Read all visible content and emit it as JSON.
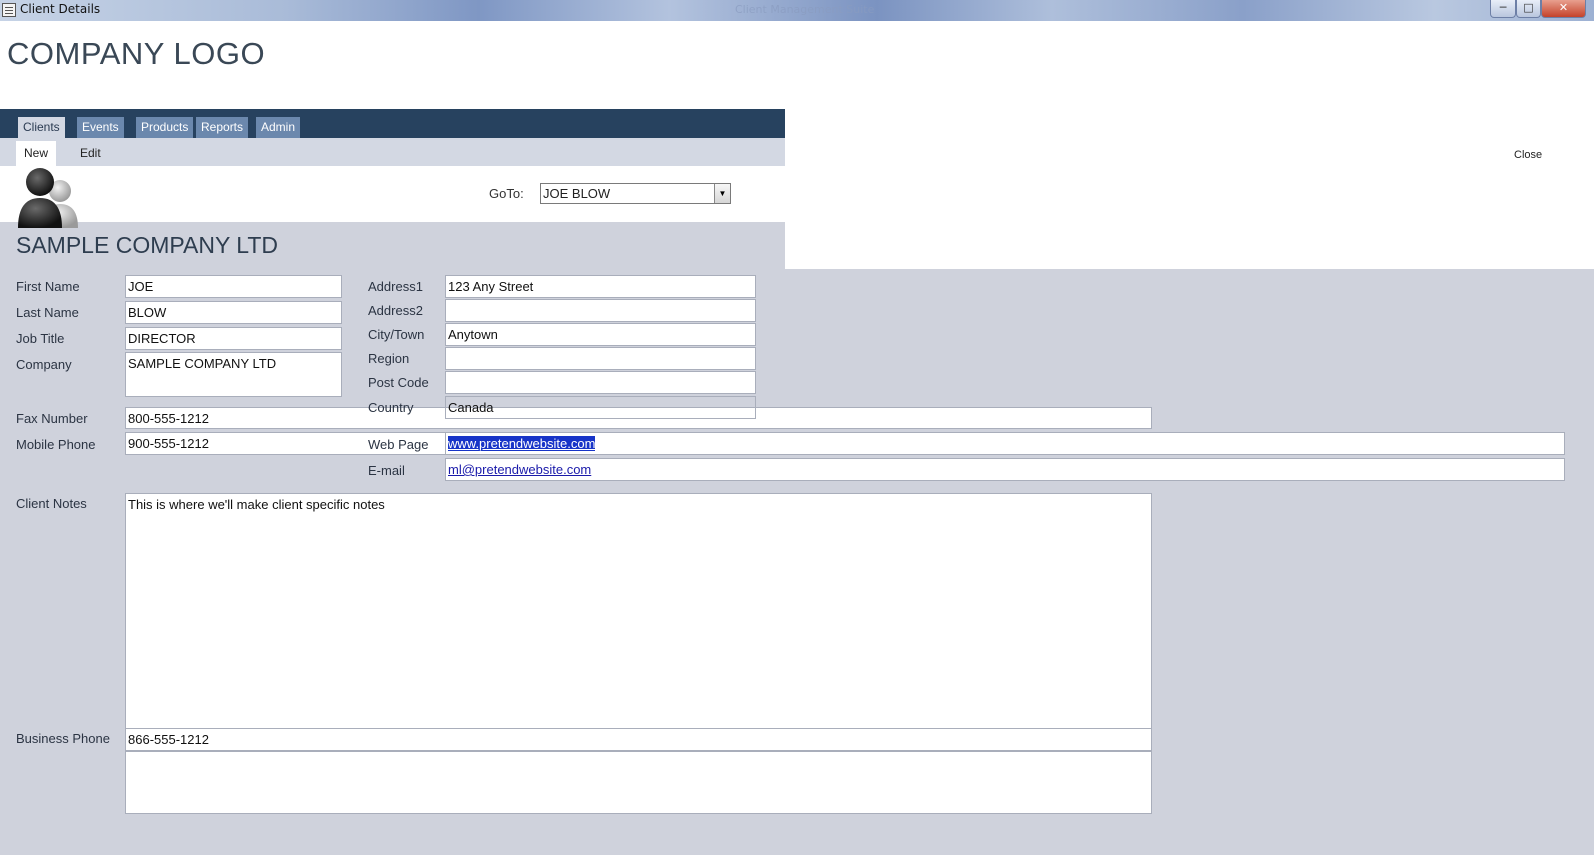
{
  "window": {
    "title": "Client Details",
    "ghost_title": "Client Management Suite",
    "controls": {
      "minimize": "─",
      "maximize": "□",
      "close": "✕"
    }
  },
  "branding": {
    "logo_text": "COMPANY LOGO"
  },
  "nav": {
    "tabs": [
      {
        "label": "Clients",
        "active": true
      },
      {
        "label": "Events",
        "active": false
      },
      {
        "label": "Products",
        "active": false
      },
      {
        "label": "Reports",
        "active": false
      },
      {
        "label": "Admin",
        "active": false
      }
    ],
    "subtabs": [
      {
        "label": "New",
        "active": true
      },
      {
        "label": "Edit",
        "active": false
      }
    ],
    "close_label": "Close"
  },
  "goto": {
    "label": "GoTo:",
    "value": "JOE BLOW"
  },
  "company_heading": "SAMPLE COMPANY LTD",
  "fields": {
    "first_name": {
      "label": "First Name",
      "value": "JOE"
    },
    "last_name": {
      "label": "Last Name",
      "value": "BLOW"
    },
    "job_title": {
      "label": "Job Title",
      "value": "DIRECTOR"
    },
    "company": {
      "label": "Company",
      "value": "SAMPLE COMPANY LTD"
    },
    "fax_number": {
      "label": "Fax Number",
      "value": "800-555-1212"
    },
    "mobile_phone": {
      "label": "Mobile Phone",
      "value": "900-555-1212"
    },
    "client_notes": {
      "label": "Client Notes",
      "value": "This is where we'll make client specific notes"
    },
    "business_phone": {
      "label": "Business Phone",
      "value": "866-555-1212"
    },
    "address1": {
      "label": "Address1",
      "value": "123 Any Street"
    },
    "address2": {
      "label": "Address2",
      "value": ""
    },
    "city": {
      "label": "City/Town",
      "value": "Anytown"
    },
    "region": {
      "label": "Region",
      "value": ""
    },
    "post_code": {
      "label": "Post Code",
      "value": ""
    },
    "country": {
      "label": "Country",
      "value": "Canada"
    },
    "web_page": {
      "label": "Web Page",
      "value": "www.pretendwebsite.com"
    },
    "email": {
      "label": "E-mail",
      "value": "ml@pretendwebsite.com"
    }
  },
  "colors": {
    "navbar": "#27425f",
    "tab": "#6b88ad",
    "form_background": "#cfd2dc",
    "link": "#1a1aaa",
    "selection": "#1734c8"
  }
}
